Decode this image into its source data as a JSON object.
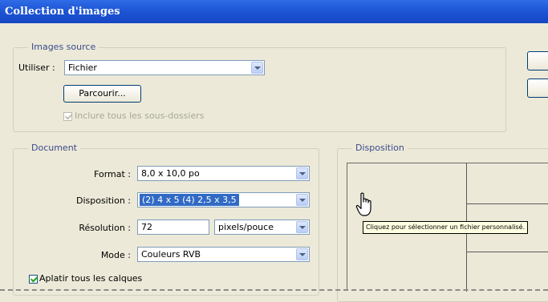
{
  "window": {
    "title": "Collection d'images"
  },
  "source": {
    "legend": "Images source",
    "use_label": "Utiliser :",
    "use_value": "Fichier",
    "browse_label": "Parcourir...",
    "subfolders_label": "Inclure tous les sous-dossiers",
    "subfolders_checked": true
  },
  "document": {
    "legend": "Document",
    "format_label": "Format :",
    "format_value": "8,0 x 10,0 po",
    "layout_label": "Disposition :",
    "layout_value": "(2) 4 x 5 (4) 2,5 x 3,5",
    "resolution_label": "Résolution :",
    "resolution_value": "72",
    "resolution_unit": "pixels/pouce",
    "mode_label": "Mode :",
    "mode_value": "Couleurs RVB",
    "flatten_label": "Aplatir tous les calques",
    "flatten_checked": true
  },
  "layout_panel": {
    "legend": "Disposition",
    "tooltip": "Cliquez pour sélectionner un fichier personnalisé."
  },
  "colors": {
    "title_bar": "#1e56d6",
    "legend_text": "#3a4a8c",
    "selection": "#316ac5"
  },
  "icons": {
    "cursor": "hand-pointer-icon",
    "dropdown": "chevron-down-icon"
  }
}
